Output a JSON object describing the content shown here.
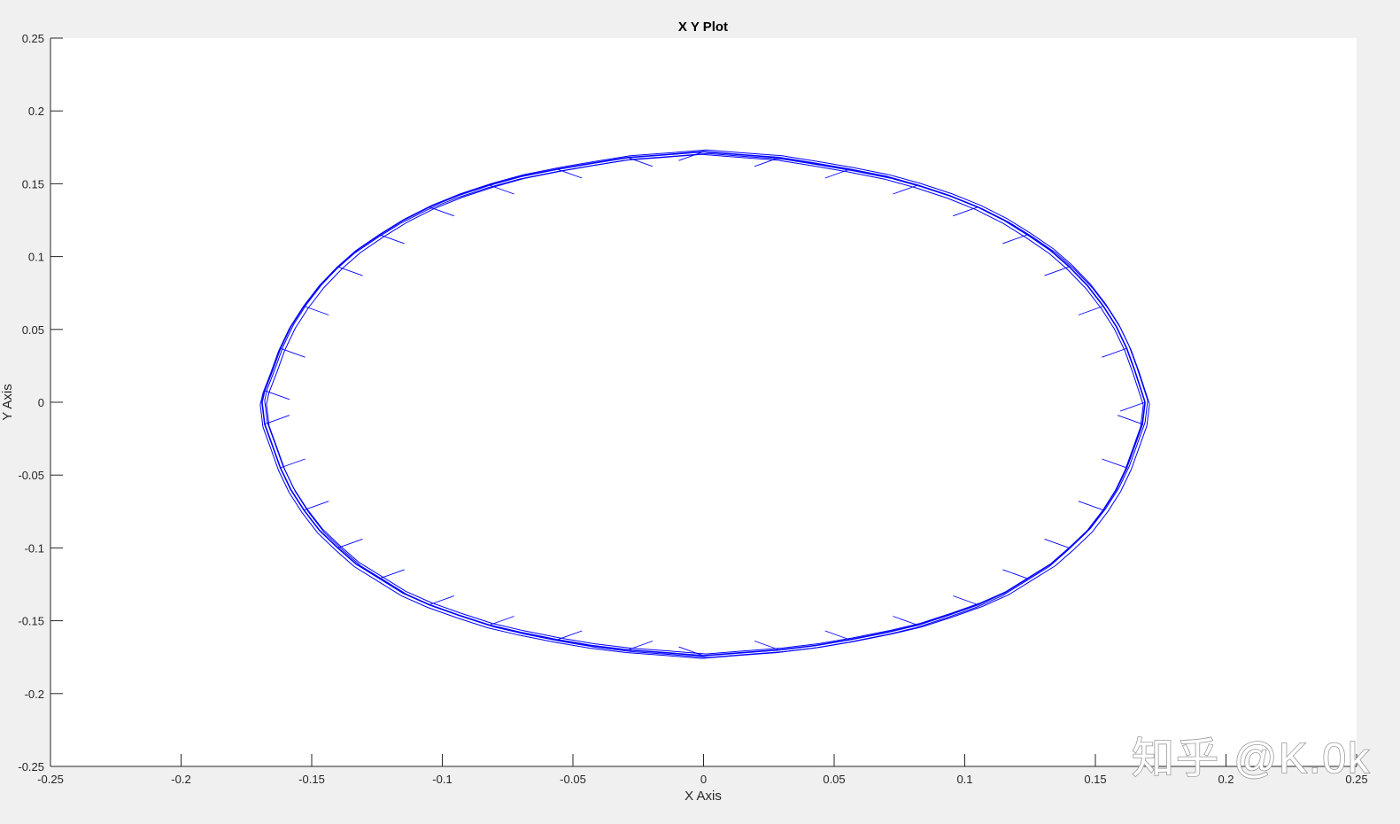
{
  "chart_data": {
    "type": "line",
    "title": "X Y Plot",
    "xlabel": "X Axis",
    "ylabel": "Y Axis",
    "xlim": [
      -0.25,
      0.25
    ],
    "ylim": [
      -0.25,
      0.25
    ],
    "xticks": [
      -0.25,
      -0.2,
      -0.15,
      -0.1,
      -0.05,
      0,
      0.05,
      0.1,
      0.15,
      0.2,
      0.25
    ],
    "yticks": [
      -0.25,
      -0.2,
      -0.15,
      -0.1,
      -0.05,
      0,
      0.05,
      0.1,
      0.15,
      0.2,
      0.25
    ],
    "xtick_labels": [
      "-0.25",
      "-0.2",
      "-0.15",
      "-0.1",
      "-0.05",
      "0",
      "0.05",
      "0.1",
      "0.15",
      "0.2",
      "0.25"
    ],
    "ytick_labels": [
      "-0.25",
      "-0.2",
      "-0.15",
      "-0.1",
      "-0.05",
      "0",
      "0.05",
      "0.1",
      "0.15",
      "0.2",
      "0.25"
    ],
    "grid": false,
    "legend": "none",
    "series": [
      {
        "color": "#0000ff",
        "x": [
          0.169,
          0.165,
          0.162,
          0.158,
          0.153,
          0.147,
          0.14,
          0.133,
          0.124,
          0.115,
          0.105,
          0.094,
          0.082,
          0.07,
          0.056,
          0.043,
          0.029,
          0.014,
          0.0,
          -0.014,
          -0.029,
          -0.043,
          -0.056,
          -0.07,
          -0.082,
          -0.094,
          -0.105,
          -0.115,
          -0.124,
          -0.133,
          -0.14,
          -0.147,
          -0.153,
          -0.158,
          -0.162,
          -0.165,
          -0.168,
          -0.169,
          -0.168,
          -0.165,
          -0.162,
          -0.158,
          -0.153,
          -0.147,
          -0.14,
          -0.133,
          -0.124,
          -0.115,
          -0.105,
          -0.094,
          -0.082,
          -0.07,
          -0.056,
          -0.043,
          -0.029,
          -0.014,
          0.0,
          0.014,
          0.029,
          0.043,
          0.056,
          0.07,
          0.082,
          0.094,
          0.105,
          0.115,
          0.124,
          0.133,
          0.14,
          0.147,
          0.153,
          0.158,
          0.162,
          0.165,
          0.168
        ],
        "y": [
          0.0,
          0.022,
          0.037,
          0.052,
          0.066,
          0.08,
          0.093,
          0.104,
          0.115,
          0.125,
          0.134,
          0.142,
          0.149,
          0.155,
          0.16,
          0.164,
          0.168,
          0.17,
          0.172,
          0.17,
          0.168,
          0.164,
          0.16,
          0.155,
          0.149,
          0.142,
          0.134,
          0.125,
          0.115,
          0.104,
          0.093,
          0.08,
          0.066,
          0.052,
          0.037,
          0.022,
          0.008,
          0.0,
          -0.015,
          -0.03,
          -0.045,
          -0.06,
          -0.074,
          -0.088,
          -0.1,
          -0.111,
          -0.121,
          -0.131,
          -0.139,
          -0.146,
          -0.153,
          -0.158,
          -0.163,
          -0.167,
          -0.17,
          -0.172,
          -0.174,
          -0.172,
          -0.17,
          -0.167,
          -0.163,
          -0.158,
          -0.153,
          -0.146,
          -0.139,
          -0.131,
          -0.121,
          -0.111,
          -0.1,
          -0.088,
          -0.074,
          -0.06,
          -0.045,
          -0.03,
          -0.015
        ]
      }
    ]
  },
  "watermark": {
    "text": "知乎 @K.0k"
  }
}
